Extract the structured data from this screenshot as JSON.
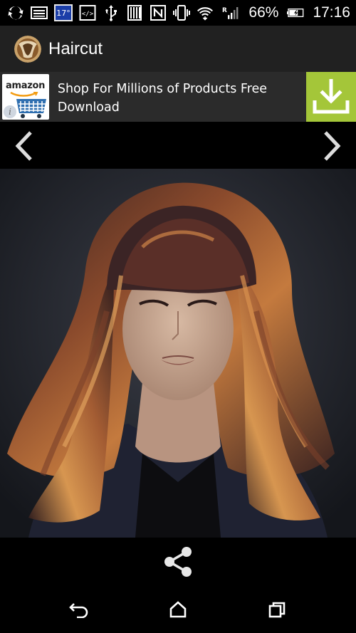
{
  "status_bar": {
    "icons": [
      "sync-icon",
      "image-notification-icon",
      "weather-icon",
      "code-icon",
      "usb-icon",
      "sd-card-icon",
      "nfc-icon",
      "vibrate-icon",
      "wifi-icon",
      "signal-roaming-icon",
      "battery-charging-icon"
    ],
    "temperature": "17°",
    "code_glyph": "</>",
    "roaming_label": "R",
    "battery_percent": "66%",
    "battery_level": 0.66,
    "time": "17:16"
  },
  "app_bar": {
    "title": "Haircut",
    "logo_icon": "haircut-app-logo"
  },
  "ad_banner": {
    "brand_logo_text": "amazon",
    "text": "Shop For Millions of Products Free Download",
    "info_glyph": "i",
    "cta_icon": "download-icon",
    "cta_color": "#a4c639"
  },
  "navigation": {
    "prev_icon": "chevron-left-icon",
    "next_icon": "chevron-right-icon"
  },
  "image_viewer": {
    "content": "haircut-photo"
  },
  "actions": {
    "share_icon": "share-icon"
  },
  "system_nav": {
    "back_icon": "back-icon",
    "home_icon": "home-icon",
    "recents_icon": "recents-icon"
  }
}
